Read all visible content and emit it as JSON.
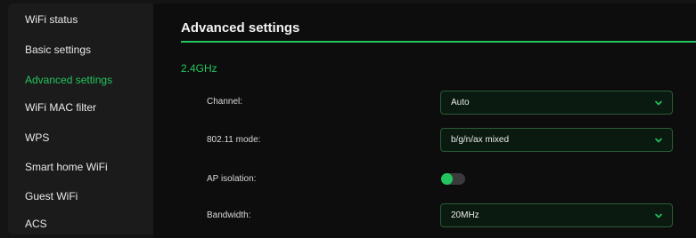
{
  "sidebar": {
    "items": [
      {
        "label": "WiFi status",
        "active": false
      },
      {
        "label": "Basic settings",
        "active": false
      },
      {
        "label": "Advanced settings",
        "active": true
      },
      {
        "label": "WiFi MAC filter",
        "active": false
      },
      {
        "label": "WPS",
        "active": false
      },
      {
        "label": "Smart home WiFi",
        "active": false
      },
      {
        "label": "Guest WiFi",
        "active": false
      },
      {
        "label": "ACS",
        "active": false
      }
    ]
  },
  "main": {
    "title": "Advanced settings",
    "band": "2.4GHz",
    "settings": {
      "channel": {
        "label": "Channel:",
        "value": "Auto"
      },
      "mode": {
        "label": "802.11 mode:",
        "value": "b/g/n/ax mixed"
      },
      "ap_isolation": {
        "label": "AP isolation:",
        "enabled": false
      },
      "bandwidth": {
        "label": "Bandwidth:",
        "value": "20MHz"
      }
    }
  },
  "colors": {
    "accent": "#22c55e",
    "sidebar_bg": "#1b1b1b",
    "main_bg": "#0d0d0d",
    "select_bg": "#0b1a10",
    "select_border": "#2b5c36"
  },
  "icons": {
    "dropdown": "chevron-down-icon"
  }
}
